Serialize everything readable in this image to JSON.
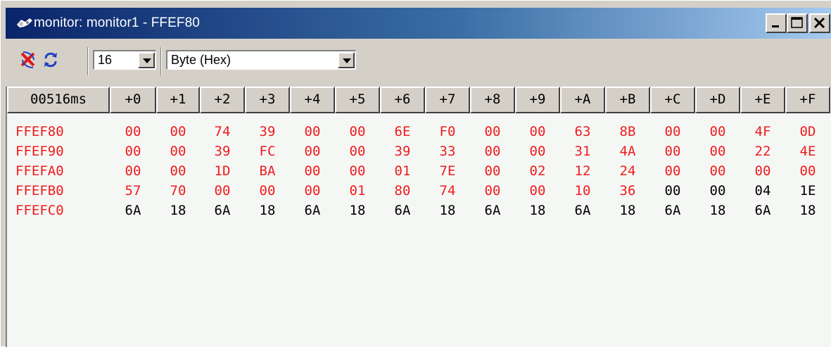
{
  "window": {
    "title": "monitor: monitor1 - FFEF80",
    "icon": "monitor-app-icon"
  },
  "caption_buttons": [
    "minimize",
    "maximize",
    "close"
  ],
  "toolbar": {
    "stop_icon": "stop-update-icon",
    "refresh_icon": "refresh-icon",
    "columns_value": "16",
    "format_value": "Byte (Hex)"
  },
  "colors": {
    "changed": "#ee1c1c",
    "unchanged": "#000000",
    "background": "#f5f7f5",
    "title_dark": "#0a246a"
  },
  "grid": {
    "headers": [
      "00516ms",
      "+0",
      "+1",
      "+2",
      "+3",
      "+4",
      "+5",
      "+6",
      "+7",
      "+8",
      "+9",
      "+A",
      "+B",
      "+C",
      "+D",
      "+E",
      "+F"
    ],
    "rows": [
      {
        "address": "FFEF80",
        "values": [
          "00",
          "00",
          "74",
          "39",
          "00",
          "00",
          "6E",
          "F0",
          "00",
          "00",
          "63",
          "8B",
          "00",
          "00",
          "4F",
          "0D"
        ],
        "changed": [
          true,
          true,
          true,
          true,
          true,
          true,
          true,
          true,
          true,
          true,
          true,
          true,
          true,
          true,
          true,
          true
        ]
      },
      {
        "address": "FFEF90",
        "values": [
          "00",
          "00",
          "39",
          "FC",
          "00",
          "00",
          "39",
          "33",
          "00",
          "00",
          "31",
          "4A",
          "00",
          "00",
          "22",
          "4E"
        ],
        "changed": [
          true,
          true,
          true,
          true,
          true,
          true,
          true,
          true,
          true,
          true,
          true,
          true,
          true,
          true,
          true,
          true
        ]
      },
      {
        "address": "FFEFA0",
        "values": [
          "00",
          "00",
          "1D",
          "BA",
          "00",
          "00",
          "01",
          "7E",
          "00",
          "02",
          "12",
          "24",
          "00",
          "00",
          "00",
          "00"
        ],
        "changed": [
          true,
          true,
          true,
          true,
          true,
          true,
          true,
          true,
          true,
          true,
          true,
          true,
          true,
          true,
          true,
          true
        ]
      },
      {
        "address": "FFEFB0",
        "values": [
          "57",
          "70",
          "00",
          "00",
          "00",
          "01",
          "80",
          "74",
          "00",
          "00",
          "10",
          "36",
          "00",
          "00",
          "04",
          "1E"
        ],
        "changed": [
          true,
          true,
          true,
          true,
          true,
          true,
          true,
          true,
          true,
          true,
          true,
          true,
          false,
          false,
          false,
          false
        ]
      },
      {
        "address": "FFEFC0",
        "values": [
          "6A",
          "18",
          "6A",
          "18",
          "6A",
          "18",
          "6A",
          "18",
          "6A",
          "18",
          "6A",
          "18",
          "6A",
          "18",
          "6A",
          "18"
        ],
        "changed": [
          false,
          false,
          false,
          false,
          false,
          false,
          false,
          false,
          false,
          false,
          false,
          false,
          false,
          false,
          false,
          false
        ]
      }
    ]
  }
}
